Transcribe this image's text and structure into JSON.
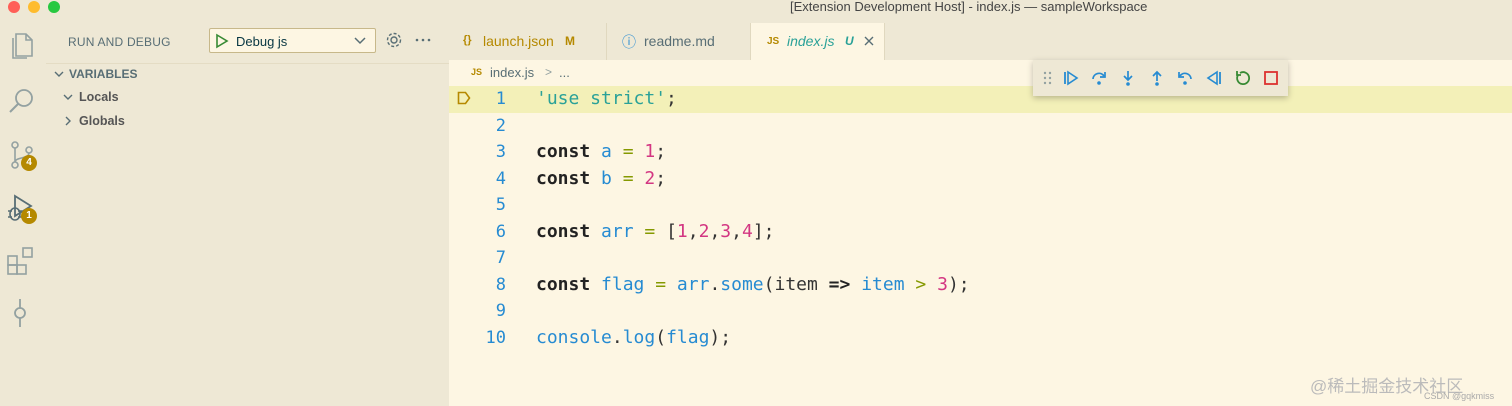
{
  "window": {
    "title": "[Extension Development Host] - index.js — sampleWorkspace"
  },
  "activity_bar": {
    "items": [
      {
        "name": "explorer",
        "icon": "files-icon"
      },
      {
        "name": "search",
        "icon": "search-icon"
      },
      {
        "name": "source-control",
        "icon": "source-control-icon",
        "badge": "4"
      },
      {
        "name": "run-and-debug",
        "icon": "debug-icon",
        "badge": "1"
      },
      {
        "name": "extensions",
        "icon": "extensions-icon"
      },
      {
        "name": "timeline",
        "icon": "git-commit-icon"
      }
    ]
  },
  "sidebar": {
    "title": "RUN AND DEBUG",
    "config_select": {
      "value": "Debug js"
    },
    "section": {
      "title": "VARIABLES"
    },
    "scopes": [
      {
        "label": "Locals",
        "expanded": true
      },
      {
        "label": "Globals",
        "expanded": false
      }
    ]
  },
  "tabs": [
    {
      "icon_text": "{}",
      "label": "launch.json",
      "status": "M",
      "active": false
    },
    {
      "icon_text": "ⓘ",
      "label": "readme.md",
      "status": "",
      "active": false
    },
    {
      "icon_text": "JS",
      "label": "index.js",
      "status": "U",
      "active": true
    }
  ],
  "breadcrumb": {
    "icon_text": "JS",
    "file": "index.js",
    "separator": ">",
    "rest": "..."
  },
  "debug_toolbar": {
    "buttons": [
      "continue-icon",
      "step-over-icon",
      "step-into-icon",
      "step-out-icon",
      "step-back-icon",
      "reverse-continue-icon",
      "restart-icon",
      "stop-icon"
    ]
  },
  "editor": {
    "current_line": 1,
    "lines": [
      {
        "n": "1",
        "tokens": [
          [
            "str",
            "'use strict'"
          ],
          [
            "punc",
            ";"
          ]
        ]
      },
      {
        "n": "2",
        "tokens": []
      },
      {
        "n": "3",
        "tokens": [
          [
            "kw",
            "const"
          ],
          [
            "punc",
            " "
          ],
          [
            "var",
            "a"
          ],
          [
            "punc",
            " "
          ],
          [
            "op",
            "="
          ],
          [
            "punc",
            " "
          ],
          [
            "num",
            "1"
          ],
          [
            "punc",
            ";"
          ]
        ]
      },
      {
        "n": "4",
        "tokens": [
          [
            "kw",
            "const"
          ],
          [
            "punc",
            " "
          ],
          [
            "var",
            "b"
          ],
          [
            "punc",
            " "
          ],
          [
            "op",
            "="
          ],
          [
            "punc",
            " "
          ],
          [
            "num",
            "2"
          ],
          [
            "punc",
            ";"
          ]
        ]
      },
      {
        "n": "5",
        "tokens": []
      },
      {
        "n": "6",
        "tokens": [
          [
            "kw",
            "const"
          ],
          [
            "punc",
            " "
          ],
          [
            "var",
            "arr"
          ],
          [
            "punc",
            " "
          ],
          [
            "op",
            "="
          ],
          [
            "punc",
            " ["
          ],
          [
            "num",
            "1"
          ],
          [
            "punc",
            ","
          ],
          [
            "num",
            "2"
          ],
          [
            "punc",
            ","
          ],
          [
            "num",
            "3"
          ],
          [
            "punc",
            ","
          ],
          [
            "num",
            "4"
          ],
          [
            "punc",
            "];"
          ]
        ]
      },
      {
        "n": "7",
        "tokens": []
      },
      {
        "n": "8",
        "tokens": [
          [
            "kw",
            "const"
          ],
          [
            "punc",
            " "
          ],
          [
            "var",
            "flag"
          ],
          [
            "punc",
            " "
          ],
          [
            "op",
            "="
          ],
          [
            "punc",
            " "
          ],
          [
            "var",
            "arr"
          ],
          [
            "punc",
            "."
          ],
          [
            "fn",
            "some"
          ],
          [
            "punc",
            "(item "
          ],
          [
            "kw",
            "=>"
          ],
          [
            "punc",
            " "
          ],
          [
            "var",
            "item"
          ],
          [
            "punc",
            " "
          ],
          [
            "op",
            ">"
          ],
          [
            "punc",
            " "
          ],
          [
            "num",
            "3"
          ],
          [
            "punc",
            ");"
          ]
        ]
      },
      {
        "n": "9",
        "tokens": []
      },
      {
        "n": "10",
        "tokens": [
          [
            "var",
            "console"
          ],
          [
            "punc",
            "."
          ],
          [
            "fn",
            "log"
          ],
          [
            "punc",
            "("
          ],
          [
            "var",
            "flag"
          ],
          [
            "punc",
            ");"
          ]
        ]
      }
    ]
  },
  "watermark": {
    "text": "@稀土掘金技术社区",
    "sub": "CSDN @gqkmiss"
  },
  "colors": {
    "accent": "#268bd2",
    "badge": "#b58900",
    "current_line": "#f3f0b8",
    "background": "#fdf6e3"
  }
}
